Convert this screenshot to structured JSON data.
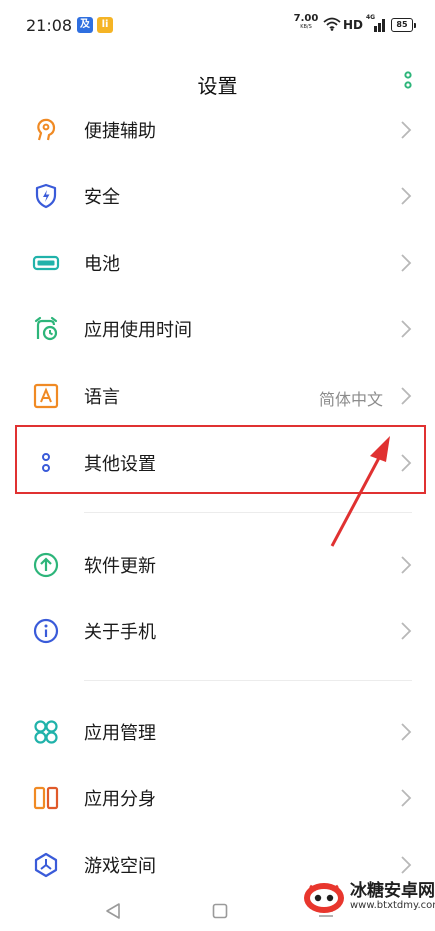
{
  "status_bar": {
    "time": "21:08",
    "badge_1": "及",
    "badge_2": "li",
    "net_speed_value": "7.00",
    "net_speed_unit": "KB/S",
    "hd": "HD",
    "signal_tag": "4G",
    "battery": "85"
  },
  "header": {
    "title": "设置"
  },
  "settings": [
    {
      "label": "便捷辅助",
      "icon": "assist-hand-icon",
      "value": ""
    },
    {
      "label": "安全",
      "icon": "shield-bolt-icon",
      "value": ""
    },
    {
      "label": "电池",
      "icon": "battery-icon",
      "value": ""
    },
    {
      "label": "应用使用时间",
      "icon": "alarm-clock-icon",
      "value": ""
    },
    {
      "label": "语言",
      "icon": "language-a-icon",
      "value": "简体中文"
    },
    {
      "label": "其他设置",
      "icon": "two-dots-icon",
      "value": ""
    },
    {
      "label": "软件更新",
      "icon": "arrow-up-circle-icon",
      "value": ""
    },
    {
      "label": "关于手机",
      "icon": "info-circle-icon",
      "value": ""
    },
    {
      "label": "应用管理",
      "icon": "four-circles-icon",
      "value": ""
    },
    {
      "label": "应用分身",
      "icon": "split-app-icon",
      "value": ""
    },
    {
      "label": "游戏空间",
      "icon": "game-space-icon",
      "value": ""
    }
  ],
  "watermark": {
    "name": "冰糖安卓网",
    "url": "www.btxtdmy.com"
  },
  "colors": {
    "accent_green": "#2db57a",
    "highlight_red": "#e03131",
    "icon_orange": "#f08a24",
    "icon_blue": "#3a5bd9",
    "icon_teal": "#20b2aa"
  }
}
